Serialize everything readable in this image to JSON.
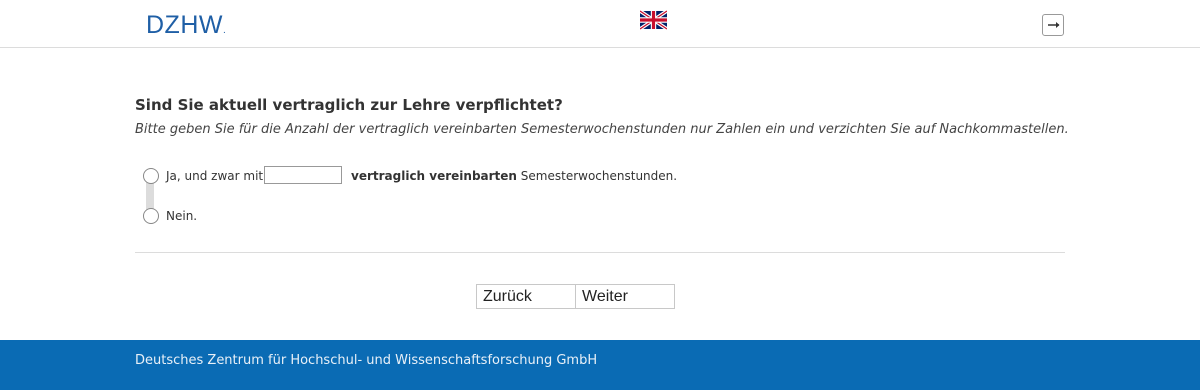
{
  "header": {
    "logo_text": "DZHW",
    "logo_dot": ".",
    "language_icon": "uk-flag-icon",
    "logout_icon": "logout-icon"
  },
  "question": {
    "title": "Sind Sie aktuell vertraglich zur Lehre verpflichtet?",
    "instruction": "Bitte geben Sie für die Anzahl der vertraglich vereinbarten Semesterwochenstunden nur Zahlen ein und verzichten Sie auf Nachkommastellen.",
    "options": [
      {
        "label": "Ja, und zwar mit",
        "input_value": "",
        "suffix_bold": "vertraglich vereinbarten",
        "suffix_rest": " Semesterwochenstunden."
      },
      {
        "label": "Nein."
      }
    ]
  },
  "navigation": {
    "back_label": "Zurück",
    "next_label": "Weiter"
  },
  "footer": {
    "text": "Deutsches Zentrum für Hochschul- und Wissenschaftsforschung GmbH"
  },
  "colors": {
    "brand_blue": "#0a6bb4",
    "logo_blue": "#1f5fa6"
  }
}
